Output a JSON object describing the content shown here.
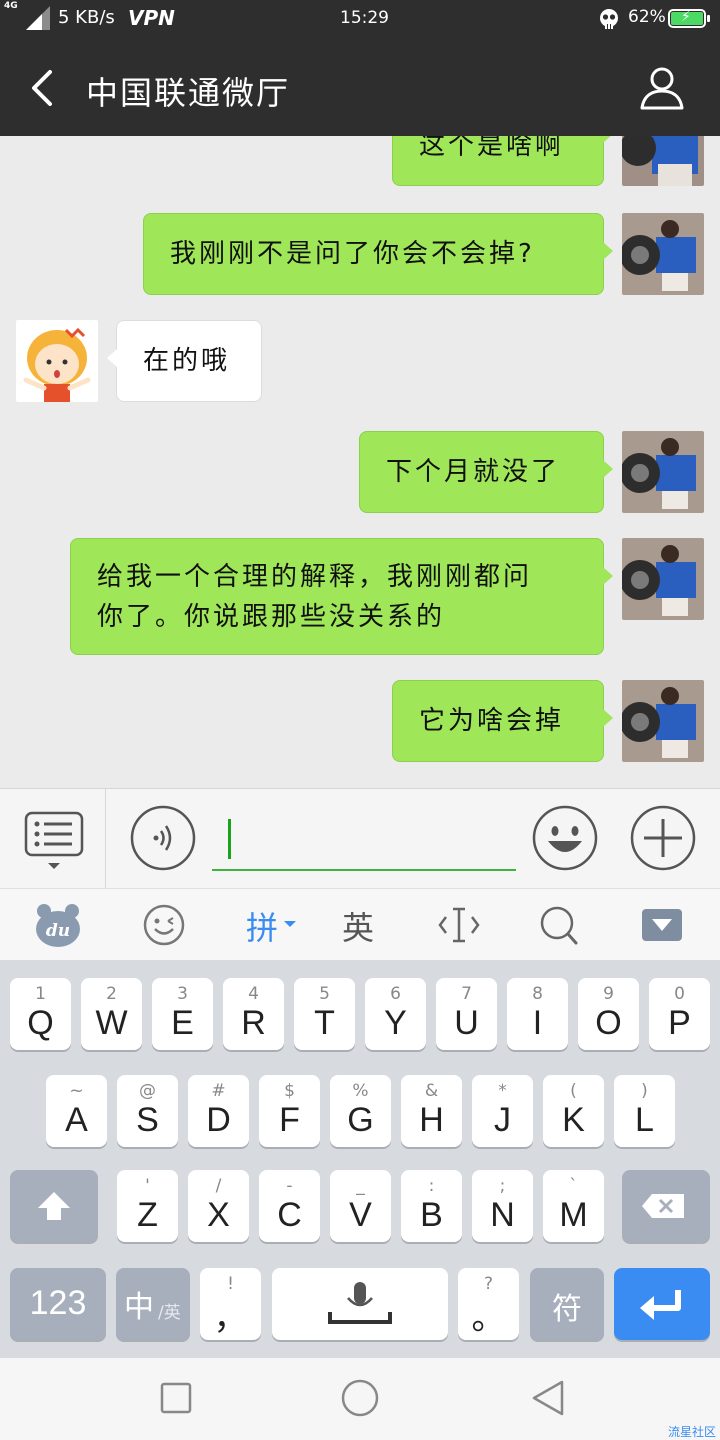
{
  "status_bar": {
    "network_type": "4G",
    "speed": "5 KB/s",
    "vpn": "VPN",
    "time": "15:29",
    "battery_pct": "62%",
    "icons": [
      "signal-icon",
      "skull-icon",
      "battery-charging-icon"
    ]
  },
  "header": {
    "title": "中国联通微厅",
    "icons": [
      "back-icon",
      "profile-icon"
    ]
  },
  "messages": [
    {
      "sender": "me",
      "text": "这个是啥啊"
    },
    {
      "sender": "me",
      "text": "我刚刚不是问了你会不会掉?"
    },
    {
      "sender": "bot",
      "text": "在的哦"
    },
    {
      "sender": "me",
      "text": "下个月就没了"
    },
    {
      "sender": "me",
      "text_line1": "给我一个合理的解释，我刚刚都问",
      "text_line2": "你了。你说跟那些没关系的"
    },
    {
      "sender": "me",
      "text": "它为啥会掉"
    }
  ],
  "input_bar": {
    "value": "",
    "icons": [
      "menu-icon",
      "voice-icon",
      "emoji-icon",
      "plus-icon"
    ]
  },
  "ime_toolbar": {
    "pinyin_label": "拼",
    "english_label": "英",
    "icons": [
      "baidu-du-icon",
      "emoji-face-icon",
      "cursor-icon",
      "search-icon",
      "hide-keyboard-icon"
    ]
  },
  "keyboard": {
    "row1": [
      {
        "num": "1",
        "letter": "Q"
      },
      {
        "num": "2",
        "letter": "W"
      },
      {
        "num": "3",
        "letter": "E"
      },
      {
        "num": "4",
        "letter": "R"
      },
      {
        "num": "5",
        "letter": "T"
      },
      {
        "num": "6",
        "letter": "Y"
      },
      {
        "num": "7",
        "letter": "U"
      },
      {
        "num": "8",
        "letter": "I"
      },
      {
        "num": "9",
        "letter": "O"
      },
      {
        "num": "0",
        "letter": "P"
      }
    ],
    "row2": [
      {
        "sym": "~",
        "letter": "A"
      },
      {
        "sym": "@",
        "letter": "S"
      },
      {
        "sym": "#",
        "letter": "D"
      },
      {
        "sym": "$",
        "letter": "F"
      },
      {
        "sym": "%",
        "letter": "G"
      },
      {
        "sym": "&",
        "letter": "H"
      },
      {
        "sym": "*",
        "letter": "J"
      },
      {
        "sym": "(",
        "letter": "K"
      },
      {
        "sym": ")",
        "letter": "L"
      }
    ],
    "row3": [
      {
        "sym": "'",
        "letter": "Z"
      },
      {
        "sym": "/",
        "letter": "X"
      },
      {
        "sym": "-",
        "letter": "C"
      },
      {
        "sym": "_",
        "letter": "V"
      },
      {
        "sym": ":",
        "letter": "B"
      },
      {
        "sym": ";",
        "letter": "N"
      },
      {
        "sym": "`",
        "letter": "M"
      }
    ],
    "bottom": {
      "num_key": "123",
      "lang_key_main": "中",
      "lang_key_sub": "/英",
      "comma_sub": "!",
      "comma": "，",
      "period_sub": "?",
      "period": "。",
      "symbol_key": "符"
    }
  },
  "nav_bar": {
    "icons": [
      "recent-apps-icon",
      "home-icon",
      "back-nav-icon"
    ]
  },
  "watermark": "流星社区",
  "colors": {
    "header_bg": "#2e2e2e",
    "chat_bg": "#ebebeb",
    "my_bubble": "#9fe658",
    "accent_blue": "#3b8cf2"
  }
}
